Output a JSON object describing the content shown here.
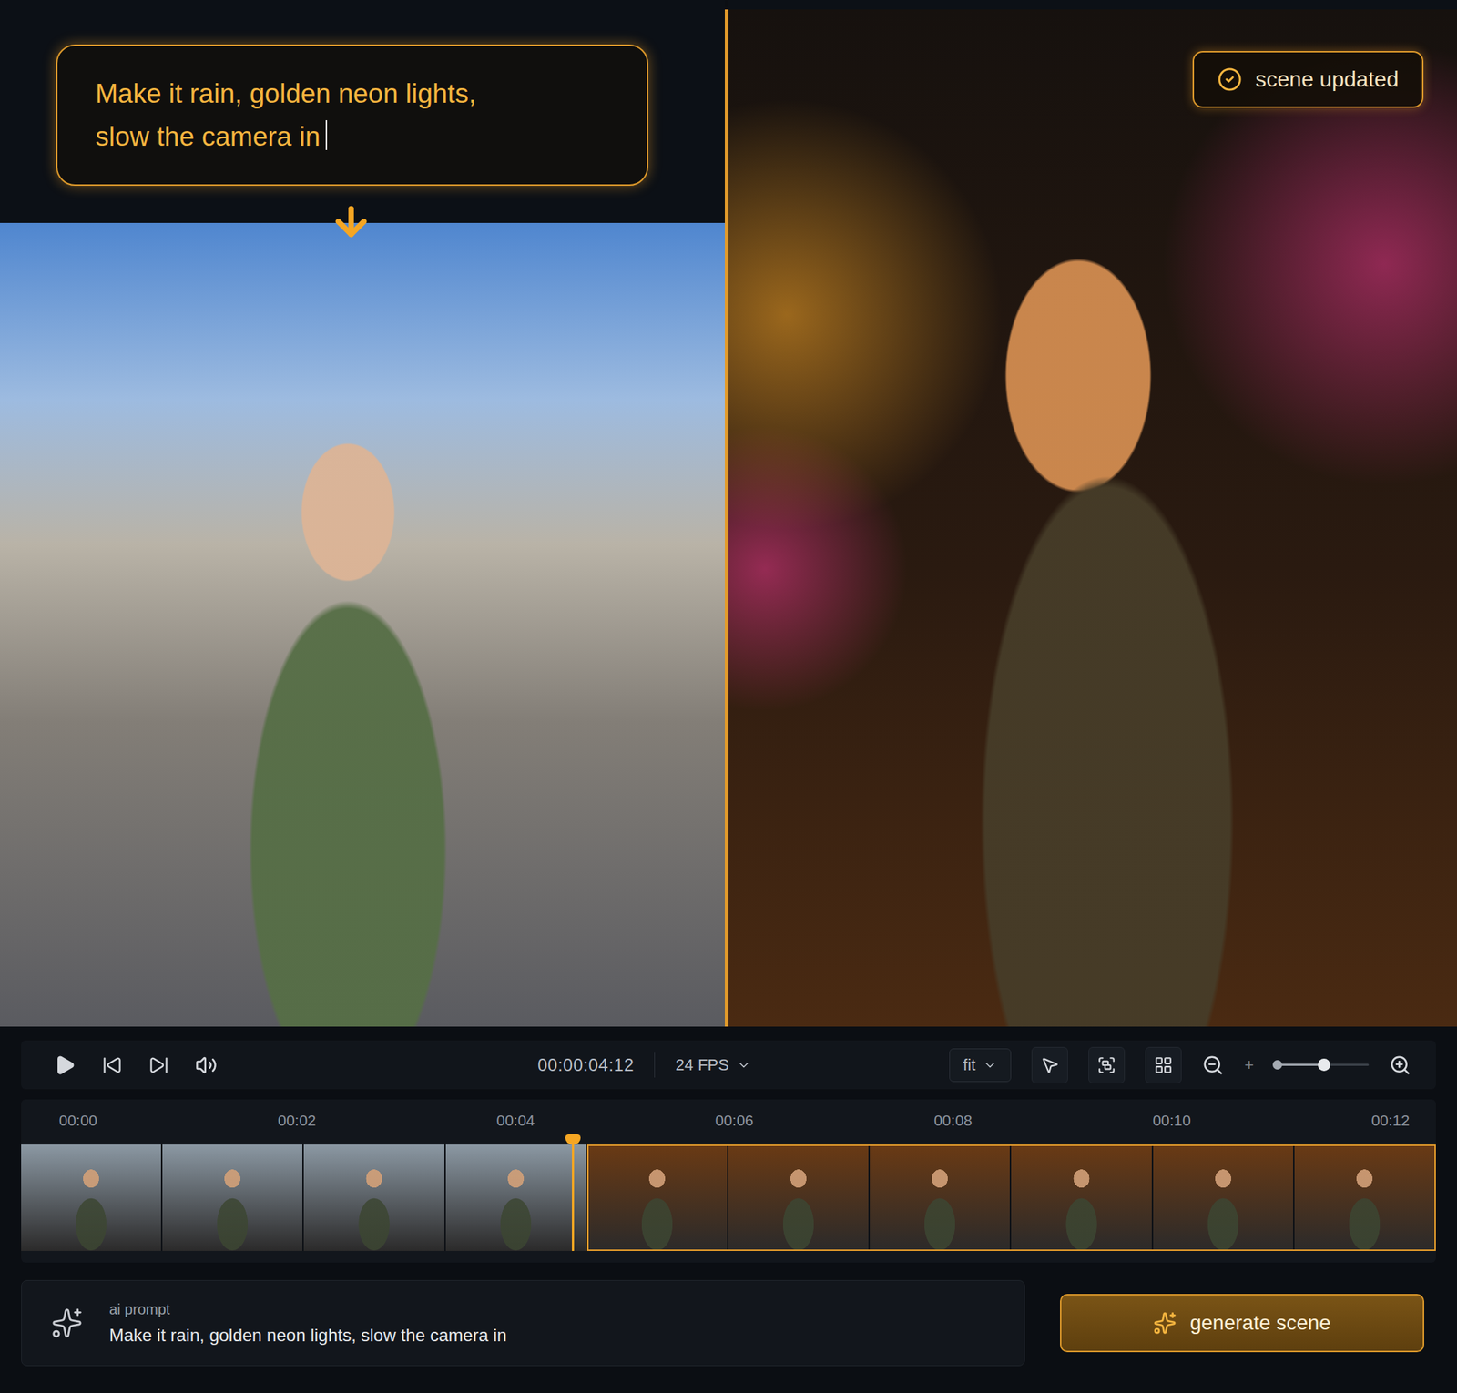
{
  "prompt_overlay": {
    "lines": [
      "Make it rain, golden neon lights,",
      "slow the camera in"
    ],
    "cursor": true
  },
  "badge": {
    "label": "scene updated"
  },
  "transport": {
    "timecode": "00:00:04:12",
    "fps": "24 FPS"
  },
  "view": {
    "fit": "fit",
    "zoom_separator": "+",
    "zoom_level": 0.52
  },
  "timeline": {
    "ticks": [
      "00:00",
      "00:02",
      "00:04",
      "00:06",
      "00:08",
      "00:10",
      "00:12"
    ],
    "playhead_level": 0.39,
    "clips": [
      {
        "frames": 4,
        "selected": false,
        "color": "#8b98a3"
      },
      {
        "frames": 6,
        "selected": true,
        "color": "#6a3a14"
      }
    ]
  },
  "ai_prompt": {
    "label": "ai prompt",
    "value": "Make it rain, golden neon lights, slow the camera in"
  },
  "buttons": [
    {
      "label": "generate scene"
    }
  ]
}
